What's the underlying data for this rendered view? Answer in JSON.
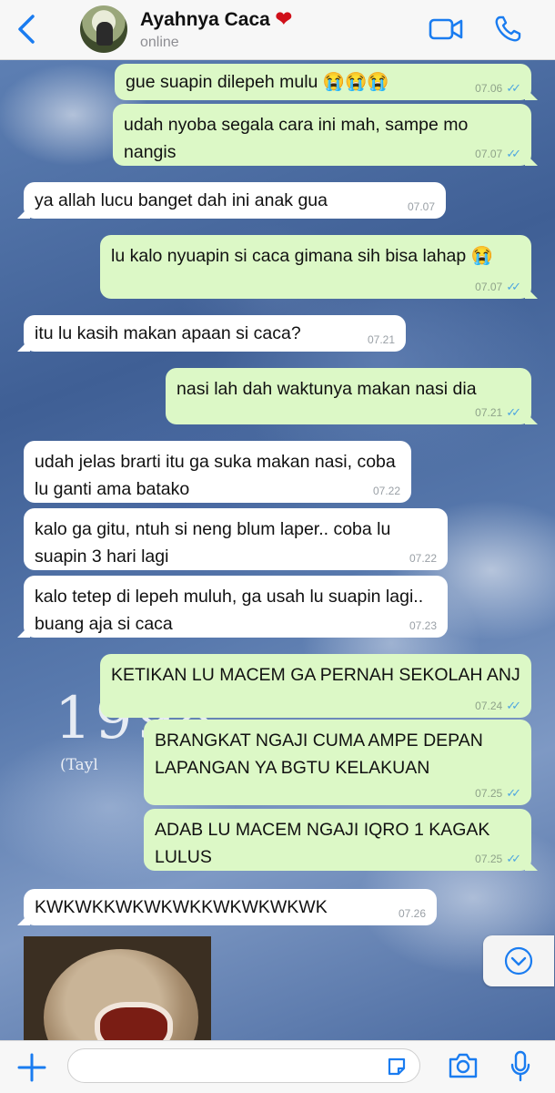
{
  "header": {
    "contact_name": "Ayahnya Caca",
    "contact_emoji": "❤",
    "status": "online"
  },
  "wallpaper": {
    "text_large": "1998",
    "text_small": "(Tayl"
  },
  "messages": [
    {
      "dir": "out",
      "text": "gue suapin dilepeh mulu 😭😭😭",
      "time": "07.06"
    },
    {
      "dir": "out",
      "text": "udah nyoba segala cara ini mah, sampe mo nangis",
      "time": "07.07"
    },
    {
      "dir": "in",
      "text": "ya allah lucu banget dah ini anak gua",
      "time": "07.07"
    },
    {
      "dir": "out",
      "text": "lu kalo nyuapin si caca gimana sih bisa lahap 😭",
      "time": "07.07"
    },
    {
      "dir": "in",
      "text": "itu lu kasih makan apaan si caca?",
      "time": "07.21"
    },
    {
      "dir": "out",
      "text": "nasi lah dah waktunya makan nasi dia",
      "time": "07.21"
    },
    {
      "dir": "in",
      "text": "udah jelas brarti itu ga suka makan nasi, coba lu ganti ama batako",
      "time": "07.22"
    },
    {
      "dir": "in",
      "text": "kalo ga gitu, ntuh si neng blum laper.. coba lu suapin 3 hari lagi",
      "time": "07.22"
    },
    {
      "dir": "in",
      "text": "kalo tetep di lepeh muluh, ga usah lu suapin lagi.. buang aja si caca",
      "time": "07.23"
    },
    {
      "dir": "out",
      "text": "KETIKAN LU MACEM GA PERNAH SEKOLAH ANJ",
      "time": "07.24"
    },
    {
      "dir": "out",
      "text": "BRANGKAT NGAJI CUMA AMPE DEPAN LAPANGAN YA BGTU KELAKUAN",
      "time": "07.25"
    },
    {
      "dir": "out",
      "text": "ADAB LU MACEM NGAJI IQRO 1 KAGAK LULUS",
      "time": "07.25"
    },
    {
      "dir": "in",
      "text": "KWKWKKWKWKWKKWKWKWKWK",
      "time": "07.26"
    }
  ],
  "composer": {
    "value": "",
    "placeholder": ""
  },
  "colors": {
    "accent": "#1a7cf0",
    "outgoing_bubble": "#dcf8c6",
    "incoming_bubble": "#ffffff",
    "read_ticks": "#4fa6e0"
  },
  "icons": {
    "back": "chevron-left-icon",
    "video": "video-camera-icon",
    "call": "phone-icon",
    "plus": "plus-icon",
    "sticker": "sticker-icon",
    "camera": "camera-icon",
    "mic": "microphone-icon",
    "scroll": "chevron-down-circle-icon"
  }
}
